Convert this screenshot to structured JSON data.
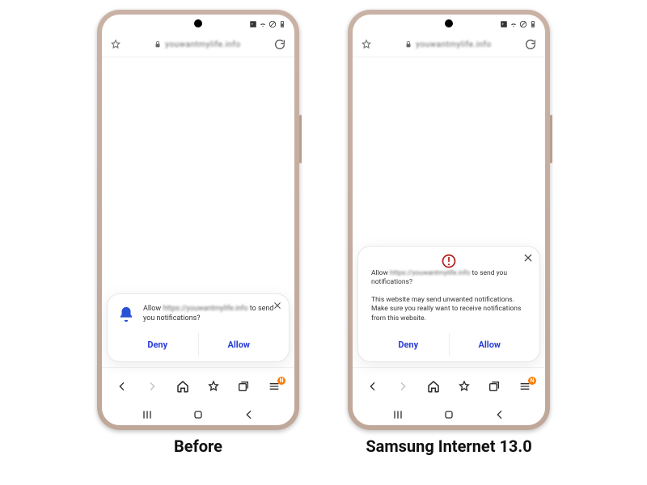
{
  "captions": {
    "left": "Before",
    "right": "Samsung Internet 13.0"
  },
  "url_display": "youwantmylife.info",
  "simple_popup": {
    "prefix": "Allow ",
    "site_blurred": "https://youwantmylife.info",
    "suffix": " to send you notifications?",
    "deny": "Deny",
    "allow": "Allow"
  },
  "warn_popup": {
    "line1_prefix": "Allow ",
    "line1_site": "https://youwantmylife.info",
    "line1_suffix": " to send you notifications?",
    "line2": "This website may send unwanted notifications. Make sure you really want to receive notifications from this website.",
    "deny": "Deny",
    "allow": "Allow"
  },
  "browser_bar_badge": "N"
}
